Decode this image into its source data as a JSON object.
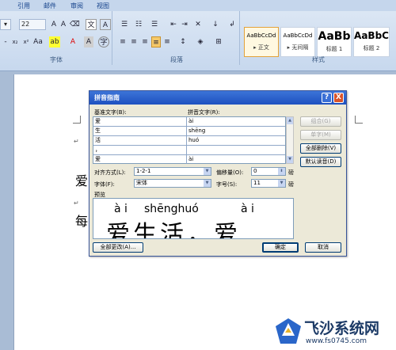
{
  "ribbon": {
    "tabs": [
      "引用",
      "邮件",
      "审阅",
      "视图"
    ],
    "font_size": "22",
    "groups": {
      "font": "字体",
      "paragraph": "段落",
      "styles": "样式"
    },
    "styles": [
      {
        "sample": "AaBbCcDd",
        "name": "▸ 正文"
      },
      {
        "sample": "AaBbCcDd",
        "name": "▸ 无间隔"
      },
      {
        "sample": "AaBb",
        "name": "标题 1"
      },
      {
        "sample": "AaBbC",
        "name": "标题 2"
      }
    ]
  },
  "document": {
    "chars": [
      "爱",
      "每"
    ],
    "para_mark": "↵"
  },
  "dialog": {
    "title": "拼音指南",
    "help": "?",
    "close": "X",
    "base_header": "基准文字(B):",
    "pinyin_header": "拼音文字(R):",
    "rows": [
      {
        "base": "爱",
        "pinyin": "ài"
      },
      {
        "base": "生",
        "pinyin": "shēng"
      },
      {
        "base": "活",
        "pinyin": "huó"
      },
      {
        "base": "，",
        "pinyin": ""
      },
      {
        "base": "爱",
        "pinyin": "ài"
      }
    ],
    "buttons": {
      "combine": "组合(G)",
      "single": "单字(M)",
      "clear_all": "全部删除(V)",
      "default_reading": "默认读音(D)",
      "change_all": "全部更改(A)...",
      "ok": "确定",
      "cancel": "取消"
    },
    "alignment_label": "对齐方式(L):",
    "alignment_value": "1-2-1",
    "offset_label": "偏移量(O):",
    "offset_value": "0",
    "offset_unit": "磅",
    "font_label": "字体(F):",
    "font_value": "宋体",
    "size_label": "字号(S):",
    "size_value": "11",
    "size_unit": "磅",
    "preview_label": "预览",
    "preview_pinyin": [
      "à i",
      "shēnghuó",
      "à i"
    ],
    "preview_text": "爱生活，爱"
  },
  "watermark": {
    "text": "飞沙系统网",
    "url": "www.fs0745.com"
  }
}
